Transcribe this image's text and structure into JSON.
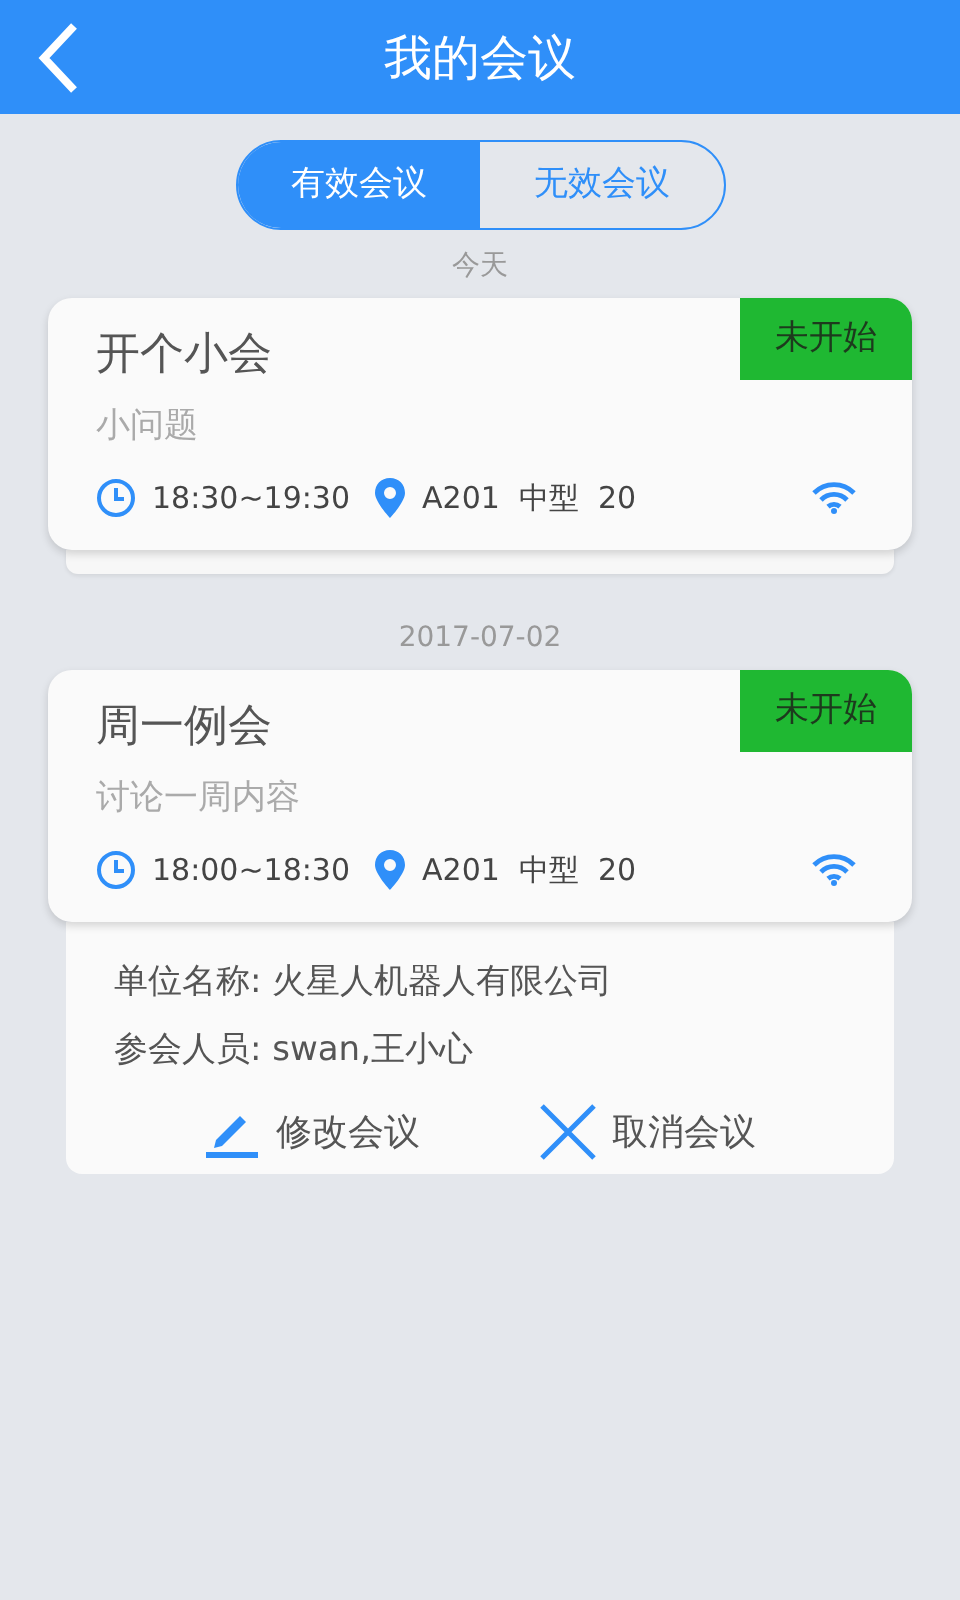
{
  "header": {
    "title": "我的会议"
  },
  "tabs": [
    {
      "label": "有效会议",
      "selected": true
    },
    {
      "label": "无效会议",
      "selected": false
    }
  ],
  "groups": [
    {
      "date": "今天",
      "meetings": [
        {
          "title": "开个小会",
          "topic": "小问题",
          "status": "未开始",
          "time": "18:30~19:30",
          "room": "A201  中型  20",
          "expanded": false
        }
      ]
    },
    {
      "date": "2017-07-02",
      "meetings": [
        {
          "title": "周一例会",
          "topic": "讨论一周内容",
          "status": "未开始",
          "time": "18:00~18:30",
          "room": "A201  中型  20",
          "expanded": true,
          "company": "单位名称: 火星人机器人有限公司",
          "attendees": "参会人员: swan,王小心",
          "actions": [
            {
              "kind": "edit",
              "label": "修改会议"
            },
            {
              "kind": "cancel",
              "label": "取消会议"
            }
          ]
        }
      ]
    }
  ]
}
